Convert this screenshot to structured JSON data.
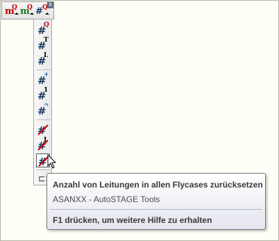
{
  "toolbar": {
    "buttons": [
      {
        "main": "m",
        "sup": "Q",
        "main_color": "#c00000"
      },
      {
        "main": "m",
        "sup": "Q",
        "main_color": "#1a7a1a"
      },
      {
        "main": "#",
        "sup": "Q",
        "main_color": "#17365d"
      }
    ],
    "close_label": "x"
  },
  "flyout": {
    "items": [
      {
        "name": "reset-flightcase-q",
        "sup": "Q"
      },
      {
        "name": "reset-flightcase-t",
        "sup": "T"
      },
      {
        "name": "reset-flightcase-l",
        "sup": "L"
      },
      {
        "name": "add-count",
        "sup": "+"
      },
      {
        "name": "set-count-one",
        "sup": "1"
      },
      {
        "name": "renumber",
        "sup": "↷"
      },
      {
        "name": "clear-count",
        "sup": "/"
      },
      {
        "name": "clear-count-i",
        "sup": "I"
      },
      {
        "name": "clear-count-all",
        "sup": "/"
      }
    ],
    "pin_icon": "pin-icon"
  },
  "tooltip": {
    "title": "Anzahl von Leitungen in allen Flycases zurücksetzen",
    "description": "ASANXX - AutoSTAGE Tools",
    "help": "F1 drücken, um weitere Hilfe zu erhalten"
  },
  "colors": {
    "hash": "#17365d",
    "accent_red": "#c00000",
    "accent_blue": "#1f5fbf"
  }
}
